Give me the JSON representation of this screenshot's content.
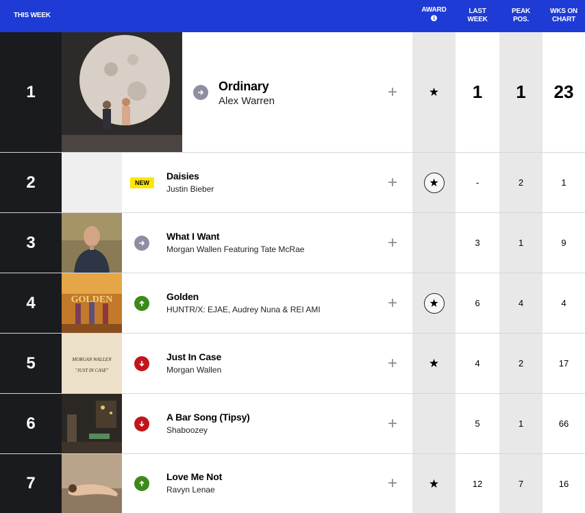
{
  "header": {
    "this_week": "THIS WEEK",
    "award": "AWARD",
    "award_info": "i",
    "last_week_1": "LAST",
    "last_week_2": "WEEK",
    "peak_1": "PEAK",
    "peak_2": "POS.",
    "wks_1": "WKS ON",
    "wks_2": "CHART",
    "bg_color": "#1e3bd6"
  },
  "rows": [
    {
      "rank": "1",
      "title": "Ordinary",
      "artist": "Alex Warren",
      "trend": "same",
      "award": "star",
      "last_week": "1",
      "peak": "1",
      "weeks": "23"
    },
    {
      "rank": "2",
      "title": "Daisies",
      "artist": "Justin Bieber",
      "trend": "new",
      "new_label": "NEW",
      "award": "star-circle",
      "last_week": "-",
      "peak": "2",
      "weeks": "1"
    },
    {
      "rank": "3",
      "title": "What I Want",
      "artist": "Morgan Wallen Featuring Tate McRae",
      "trend": "same",
      "award": "none",
      "last_week": "3",
      "peak": "1",
      "weeks": "9"
    },
    {
      "rank": "4",
      "title": "Golden",
      "artist": "HUNTR/X: EJAE, Audrey Nuna & REI AMI",
      "trend": "up",
      "award": "star-circle",
      "last_week": "6",
      "peak": "4",
      "weeks": "4"
    },
    {
      "rank": "5",
      "title": "Just In Case",
      "artist": "Morgan Wallen",
      "trend": "down",
      "award": "star",
      "last_week": "4",
      "peak": "2",
      "weeks": "17"
    },
    {
      "rank": "6",
      "title": "A Bar Song (Tipsy)",
      "artist": "Shaboozey",
      "trend": "down",
      "award": "none",
      "last_week": "5",
      "peak": "1",
      "weeks": "66"
    },
    {
      "rank": "7",
      "title": "Love Me Not",
      "artist": "Ravyn Lenae",
      "trend": "up",
      "award": "star",
      "last_week": "12",
      "peak": "7",
      "weeks": "16"
    }
  ],
  "art": {
    "row1": "moon-couple-art",
    "row2": "blank-art",
    "row3": "man-portrait-art",
    "row4": "golden-art",
    "row4_text": "GOLDEN",
    "row5": "handwritten-art",
    "row5_text_1": "MORGAN WALLEN",
    "row5_text_2": "\"JUST IN CASE\"",
    "row6": "bar-scene-art",
    "row7": "lying-woman-art"
  },
  "icons": {
    "plus": "+",
    "star": "★"
  }
}
